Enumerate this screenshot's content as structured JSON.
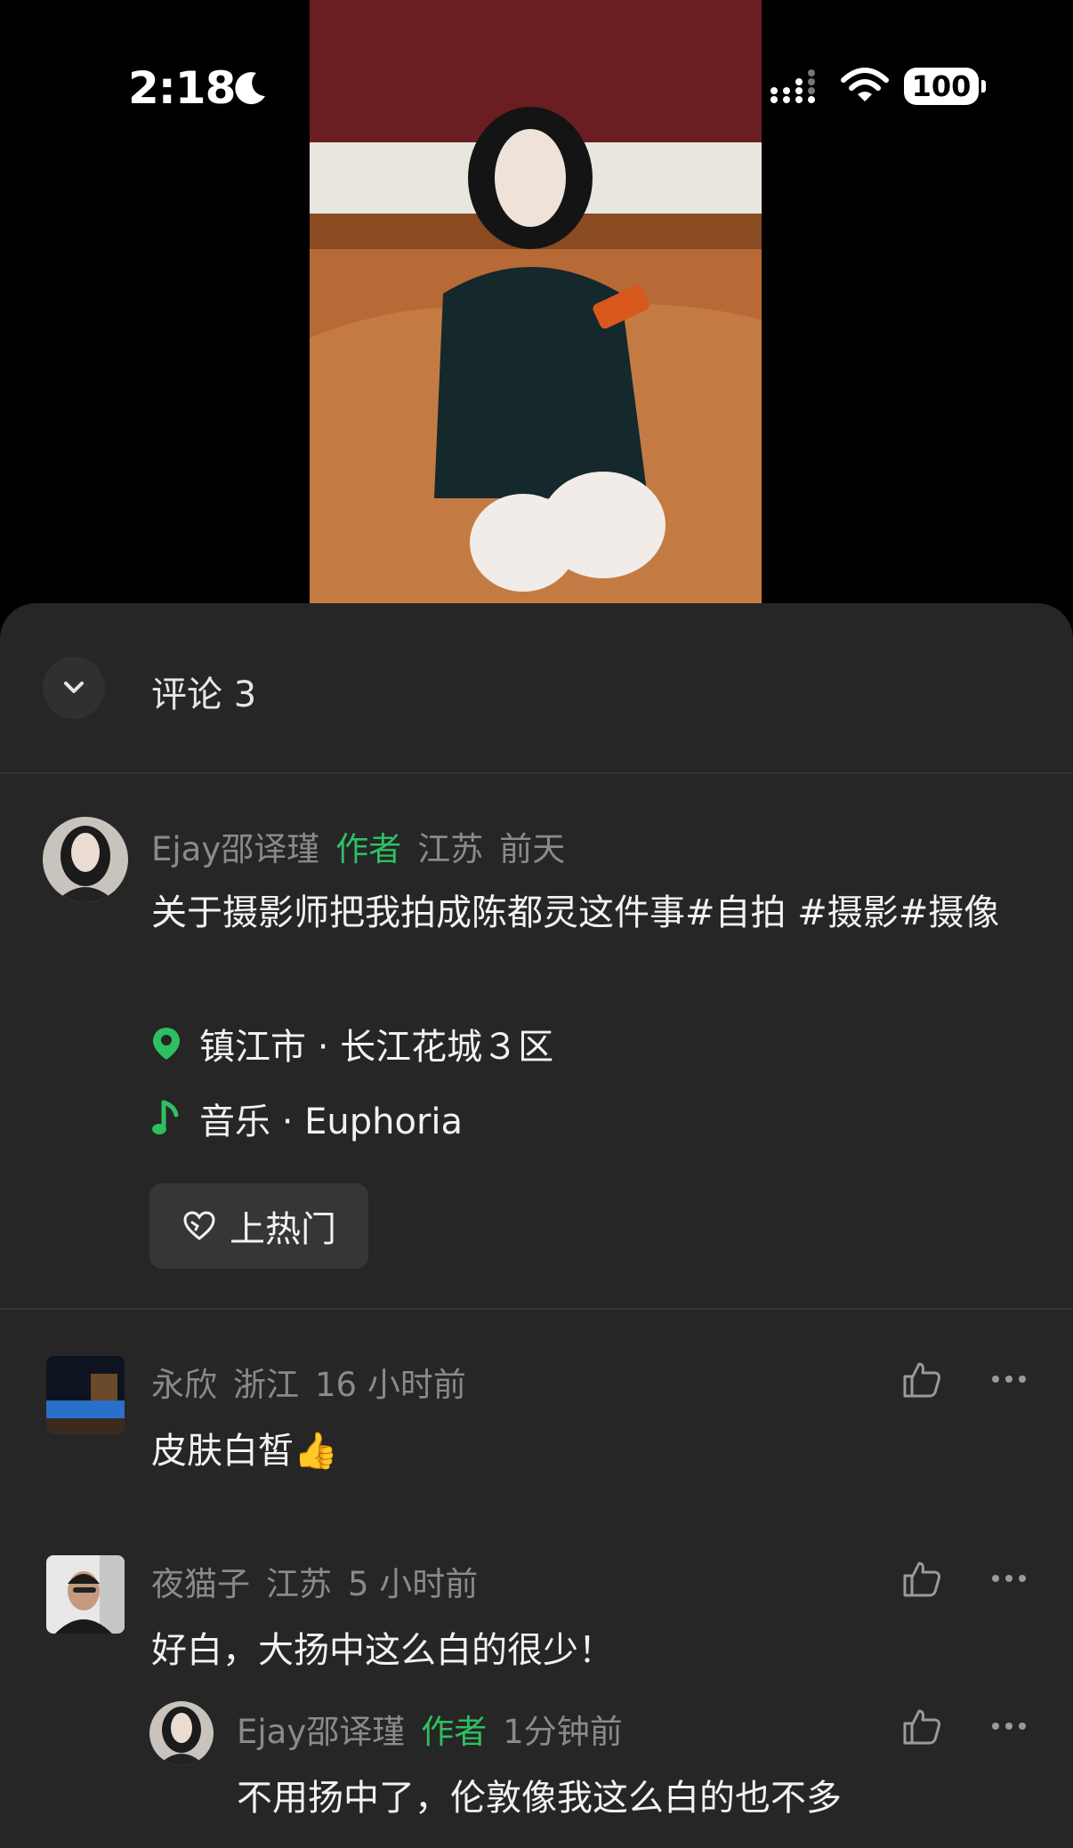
{
  "status_bar": {
    "time": "2:18",
    "battery": "100"
  },
  "comments_header": {
    "title": "评论 3"
  },
  "post": {
    "author": "Ejay邵译瑾",
    "author_badge": "作者",
    "region": "江苏",
    "time": "前天",
    "text": "关于摄影师把我拍成陈都灵这件事#自拍 #摄影#摄像",
    "location": "镇江市 · 长江花城３区",
    "music": "音乐 · Euphoria",
    "hot_button": "上热门"
  },
  "comments": [
    {
      "user": "永欣",
      "region": "浙江",
      "time": "16 小时前",
      "text": "皮肤白皙👍"
    },
    {
      "user": "夜猫子",
      "region": "江苏",
      "time": "5 小时前",
      "text": "好白，大扬中这么白的很少！",
      "reply": {
        "user": "Ejay邵译瑾",
        "badge": "作者",
        "time": "1分钟前",
        "text": "不用扬中了，伦敦像我这么白的也不多"
      }
    }
  ],
  "colors": {
    "sheet_bg": "#262626",
    "author_badge": "#2fbf62",
    "meta_text": "#8a8a8a"
  }
}
